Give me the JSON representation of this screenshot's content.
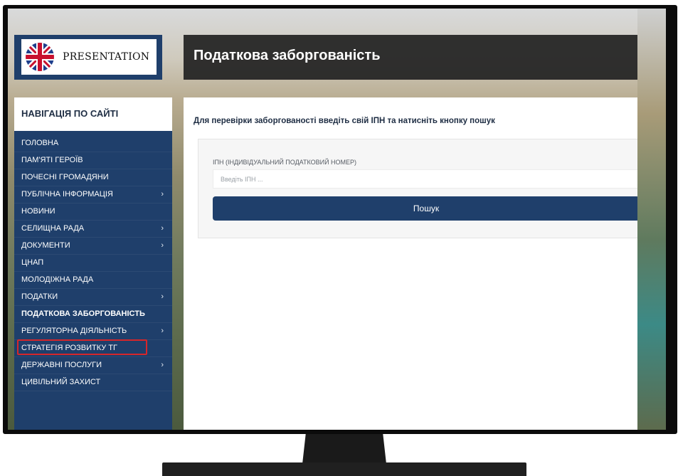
{
  "logo": {
    "text": "PRESENTATION"
  },
  "header": {
    "title": "Податкова заборгованість"
  },
  "sidebar": {
    "heading": "НАВІГАЦІЯ ПО САЙТІ",
    "items": [
      {
        "label": "ГОЛОВНА",
        "has_submenu": false
      },
      {
        "label": "ПАМ'ЯТІ ГЕРОЇВ",
        "has_submenu": false
      },
      {
        "label": "ПОЧЕСНІ ГРОМАДЯНИ",
        "has_submenu": false
      },
      {
        "label": "ПУБЛІЧНА ІНФОРМАЦІЯ",
        "has_submenu": true
      },
      {
        "label": "НОВИНИ",
        "has_submenu": false
      },
      {
        "label": "СЕЛИЩНА РАДА",
        "has_submenu": true
      },
      {
        "label": "ДОКУМЕНТИ",
        "has_submenu": true
      },
      {
        "label": "ЦНАП",
        "has_submenu": false
      },
      {
        "label": "МОЛОДІЖНА РАДА",
        "has_submenu": false
      },
      {
        "label": "ПОДАТКИ",
        "has_submenu": true
      },
      {
        "label": "ПОДАТКОВА ЗАБОРГОВАНІСТЬ",
        "has_submenu": false,
        "active": true
      },
      {
        "label": "РЕГУЛЯТОРНА ДІЯЛЬНІСТЬ",
        "has_submenu": true
      },
      {
        "label": "СТРАТЕГІЯ РОЗВИТКУ ТГ",
        "has_submenu": false
      },
      {
        "label": "ДЕРЖАВНІ ПОСЛУГИ",
        "has_submenu": true
      },
      {
        "label": "ЦИВІЛЬНИЙ ЗАХИСТ",
        "has_submenu": false
      }
    ],
    "chevron": "›"
  },
  "main": {
    "intro": "Для перевірки заборгованості введіть свій ІПН та натисніть кнопку пошук",
    "form": {
      "label": "ІПН (ІНДИВІДУАЛЬНИЙ ПОДАТКОВИЙ НОМЕР)",
      "input_value": "",
      "placeholder": "Введіть ІПН ...",
      "button_label": "Пошук"
    }
  },
  "colors": {
    "sidebar_bg": "#1f3f6b",
    "header_bg": "#222222",
    "button_bg": "#1f3f6b",
    "highlight_outline": "#d7262a"
  },
  "icons": {
    "logo_flag": "uk-flag-icon",
    "submenu": "chevron-right-icon"
  }
}
